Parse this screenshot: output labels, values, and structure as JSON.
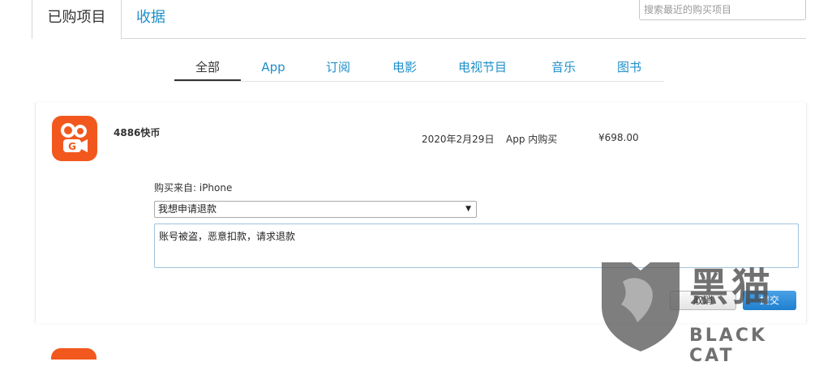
{
  "top_tabs": {
    "purchased": "已购项目",
    "receipts": "收据"
  },
  "search": {
    "placeholder": "搜索最近的购买项目"
  },
  "categories": [
    {
      "label": "全部",
      "active": true
    },
    {
      "label": "App",
      "active": false
    },
    {
      "label": "订阅",
      "active": false
    },
    {
      "label": "电影",
      "active": false
    },
    {
      "label": "电视节目",
      "active": false
    },
    {
      "label": "音乐",
      "active": false
    },
    {
      "label": "图书",
      "active": false
    }
  ],
  "purchase": {
    "app_icon": "kuaishou-app-icon",
    "name": "4886快币",
    "date": "2020年2月29日",
    "type": "App 内购买",
    "price": "¥698.00",
    "source_label": "购买来自: iPhone",
    "reason_selected": "我想申请退款",
    "reason_text": "账号被盗，恶意扣款，请求退款",
    "cancel_label": "取消",
    "submit_label": "提交"
  },
  "watermark": {
    "cn": "黑猫",
    "en": "BLACK CAT",
    "icon": "black-cat-shield-logo"
  },
  "colors": {
    "accent_blue": "#1f8fc9",
    "app_orange": "#f2581e",
    "submit_blue": "#1f7fd0"
  }
}
